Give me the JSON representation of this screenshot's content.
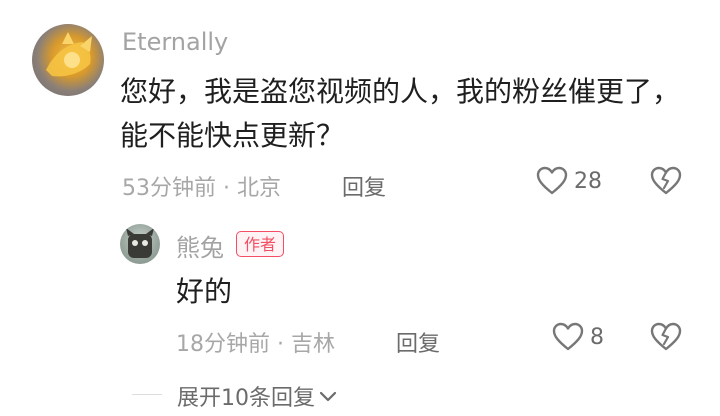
{
  "comment": {
    "username": "Eternally",
    "lines": [
      "您好，我是盗您视频的人，我的粉丝催更了，",
      "能不能快点更新？"
    ],
    "meta": "53分钟前 · 北京",
    "reply_label": "回复",
    "likes": "28"
  },
  "reply": {
    "username": "熊兔",
    "badge": "作者",
    "text": "好的",
    "meta": "18分钟前 · 吉林",
    "reply_label": "回复",
    "likes": "8"
  },
  "expand_label": "展开10条回复"
}
